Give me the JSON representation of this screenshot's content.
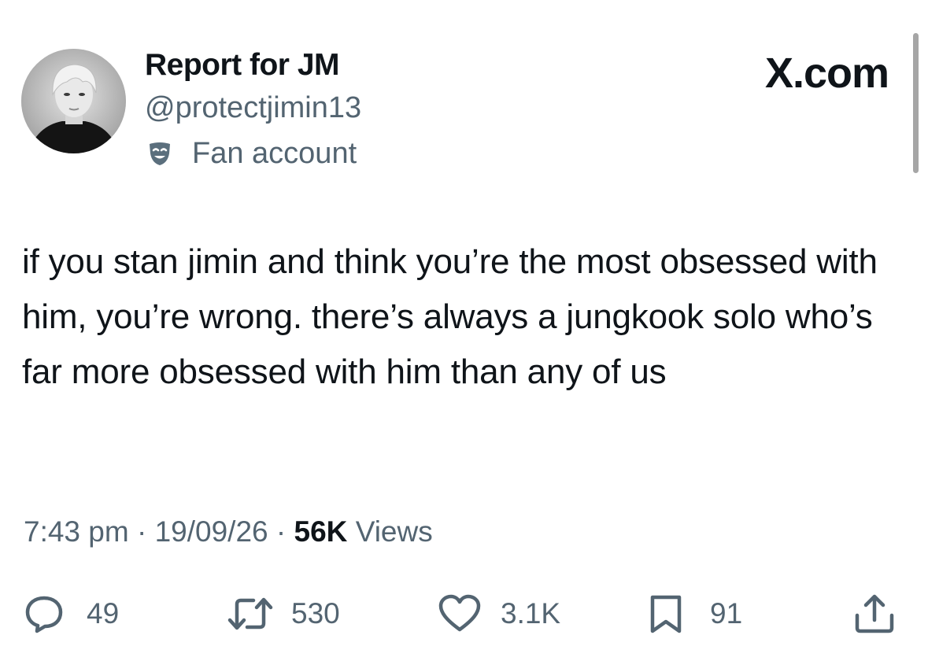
{
  "author": {
    "display_name": "Report for JM",
    "handle": "@protectjimin13",
    "label": "Fan account",
    "avatar_icon": "profile-photo",
    "label_icon": "theater-mask-icon"
  },
  "brand": {
    "text": "X.com"
  },
  "tweet": {
    "text": "if you stan jimin and think you’re the most obsessed with him, you’re wrong. there’s always a jungkook solo who’s far more obsessed with him than any of us"
  },
  "meta": {
    "time": "7:43 pm",
    "separator": "·",
    "date": "19/09/26",
    "views_count": "56K",
    "views_label": "Views"
  },
  "actions": {
    "replies": "49",
    "reposts": "530",
    "likes": "3.1K",
    "bookmarks": "91"
  },
  "colors": {
    "text": "#0f1419",
    "secondary": "#536471",
    "background": "#ffffff"
  }
}
